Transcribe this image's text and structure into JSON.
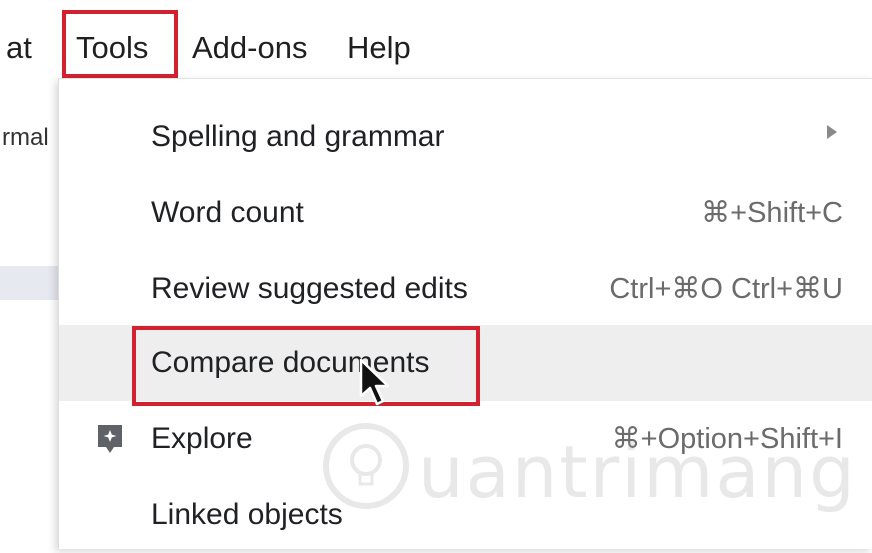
{
  "menubar": {
    "items": [
      {
        "label": "at"
      },
      {
        "label": "Tools"
      },
      {
        "label": "Add-ons"
      },
      {
        "label": "Help"
      }
    ]
  },
  "document": {
    "left_fragment": "rmal"
  },
  "tools_menu": {
    "items": [
      {
        "label": "Spelling and grammar",
        "shortcut": "",
        "submenu": true,
        "icon": ""
      },
      {
        "label": "Word count",
        "shortcut": "⌘+Shift+C",
        "submenu": false,
        "icon": ""
      },
      {
        "label": "Review suggested edits",
        "shortcut": "Ctrl+⌘O Ctrl+⌘U",
        "submenu": false,
        "icon": ""
      },
      {
        "label": "Compare documents",
        "shortcut": "",
        "submenu": false,
        "icon": "",
        "hovered": true
      },
      {
        "label": "Explore",
        "shortcut": "⌘+Option+Shift+I",
        "submenu": false,
        "icon": "explore-icon"
      },
      {
        "label": "Linked objects",
        "shortcut": "",
        "submenu": false,
        "icon": ""
      }
    ]
  },
  "highlight_color": "#d3222f",
  "watermark": {
    "text": "uantrimang",
    "icon": "lightbulb-icon"
  }
}
